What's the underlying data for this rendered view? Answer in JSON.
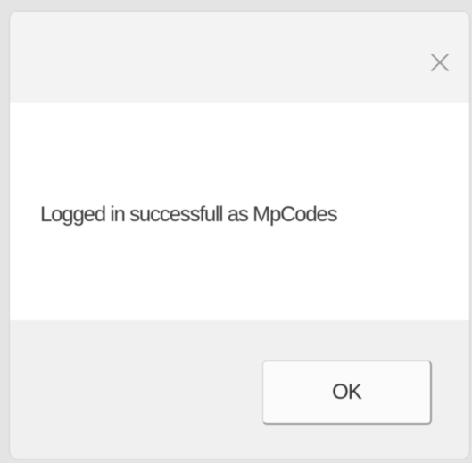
{
  "dialog": {
    "close_icon": "close-icon",
    "message": "Logged in successfull as MpCodes",
    "ok_label": "OK"
  }
}
